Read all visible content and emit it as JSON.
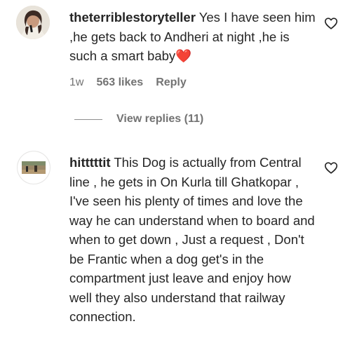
{
  "comments": [
    {
      "username": "theterriblestoryteller",
      "text": " Yes I have seen him ,he gets back to Andheri at night ,he is such a smart baby",
      "emoji": "❤️",
      "time": "1w",
      "likes": "563 likes",
      "reply_label": "Reply",
      "view_replies": "View replies (11)",
      "like_icon": "heart-outline-icon"
    },
    {
      "username": "hitttttit",
      "text": " This Dog is actually from Central line , he gets in On Kurla till Ghatkopar , I've seen his plenty of times and love the way he can understand when to board and when to get down , Just a request , Don't be Frantic when a dog get's in the compartment just leave and enjoy how well they also understand that railway connection.",
      "like_icon": "heart-outline-icon"
    }
  ]
}
